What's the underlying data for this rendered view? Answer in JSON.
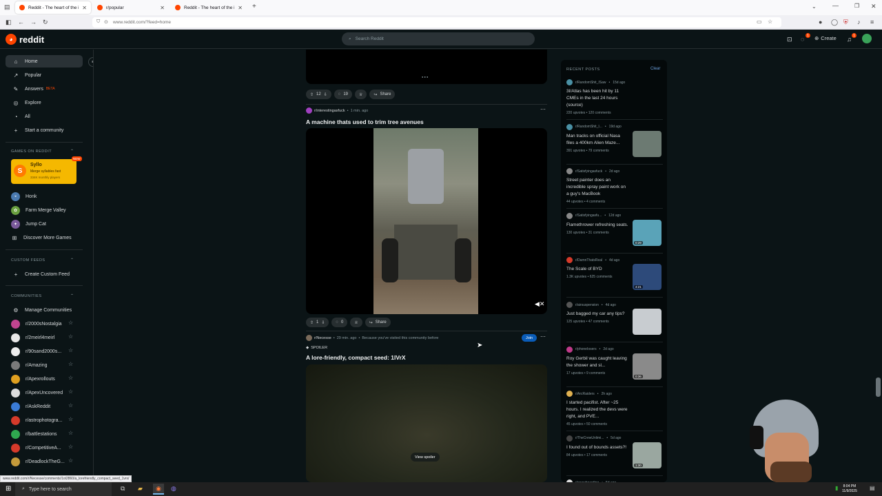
{
  "browser": {
    "tabs": [
      {
        "title": "Reddit - The heart of the intern",
        "active": true
      },
      {
        "title": "r/popular",
        "active": false
      },
      {
        "title": "Reddit - The heart of the intern",
        "active": false
      }
    ],
    "url": "www.reddit.com/?feed=home",
    "status_url": "www.reddit.com/r/Necesse/comments/1ot2860/a_lorefriendly_compact_seed_1vrx/"
  },
  "header": {
    "logo_text": "reddit",
    "search_placeholder": "Search Reddit",
    "create_label": "Create",
    "chat_badge": "1",
    "notif_badge": "1"
  },
  "sidebar": {
    "nav": [
      {
        "label": "Home",
        "icon": "home-icon",
        "selected": true
      },
      {
        "label": "Popular",
        "icon": "popular-icon"
      },
      {
        "label": "Answers",
        "icon": "answers-icon",
        "badge": "BETA"
      },
      {
        "label": "Explore",
        "icon": "explore-icon"
      },
      {
        "label": "All",
        "icon": "all-icon"
      },
      {
        "label": "Start a community",
        "icon": "plus-icon"
      }
    ],
    "games_header": "GAMES ON REDDIT",
    "featured_game": {
      "name": "Syllo",
      "desc": "Merge syllables fast",
      "players": "334K monthly players",
      "badge": "NEW"
    },
    "games": [
      "Honk",
      "Farm Merge Valley",
      "Jump Cat",
      "Discover More Games"
    ],
    "custom_feeds_header": "CUSTOM FEEDS",
    "create_feed": "Create Custom Feed",
    "communities_header": "COMMUNITIES",
    "manage": "Manage Communities",
    "communities": [
      {
        "name": "r/2000sNostalgia",
        "color": "#c0448f"
      },
      {
        "name": "r/2meirl4meirl",
        "color": "#e8e8e8"
      },
      {
        "name": "r/90sand2000s...",
        "color": "#ededed"
      },
      {
        "name": "r/Amazing",
        "color": "#7a7a7a"
      },
      {
        "name": "r/Apexrollouts",
        "color": "#e0a020"
      },
      {
        "name": "r/ApexUncovered",
        "color": "#dddddd"
      },
      {
        "name": "r/AskReddit",
        "color": "#3a7bd5"
      },
      {
        "name": "r/astrophotogra...",
        "color": "#d53a2a"
      },
      {
        "name": "r/battlestations",
        "color": "#2fa84f"
      },
      {
        "name": "r/CompetitiveA...",
        "color": "#d53a2a"
      },
      {
        "name": "r/DeadlockTheG...",
        "color": "#c49a3a"
      }
    ]
  },
  "feed": {
    "prev_post": {
      "votes": "12",
      "comments": "19",
      "share": "Share"
    },
    "post1": {
      "subreddit": "r/interestingasfuck",
      "time": "1 min. ago",
      "title": "A machine thats used to trim tree avenues",
      "votes": "1",
      "comments": "0",
      "share": "Share"
    },
    "post2": {
      "subreddit": "r/Necesse",
      "time": "29 min. ago",
      "reason": "Because you've visited this community before",
      "join": "Join",
      "flair": "SPOILER",
      "title": "A lore-friendly, compact seed: 1lVrX",
      "spoiler_button": "View spoiler"
    }
  },
  "recent": {
    "header": "RECENT POSTS",
    "clear": "Clear",
    "posts": [
      {
        "sub": "r/RandomShit_ISaw",
        "time": "15d ago",
        "title": "3I/Atlas has been hit by 11 CMEs in the last 24 hours (source)",
        "upvotes": "220 upvotes",
        "comments": "120 comments",
        "thumb": false,
        "avatar": "#4a90a4"
      },
      {
        "sub": "r/RandomShit_I...",
        "time": "19d ago",
        "title": "Man tracks on official Nasa files a 400km Alien Maze...",
        "upvotes": "391 upvotes",
        "comments": "79 comments",
        "thumb": true,
        "thumb_color": "#6c7a72",
        "duration": "",
        "avatar": "#4a90a4"
      },
      {
        "sub": "r/Satisfyingasfuck",
        "time": "2d ago",
        "title": "Street painter does an incredible spray paint work on a guy's MacBook",
        "upvotes": "44 upvotes",
        "comments": "4 comments",
        "thumb": false,
        "avatar": "#888888"
      },
      {
        "sub": "r/Satisfyingasfu...",
        "time": "12d ago",
        "title": "Flamethrower refreshing seats.",
        "upvotes": "130 upvotes",
        "comments": "31 comments",
        "thumb": true,
        "thumb_color": "#5aa3b8",
        "duration": "0:29",
        "avatar": "#888888"
      },
      {
        "sub": "r/DamnThatsReal",
        "time": "4d ago",
        "title": "The Scale of BYD",
        "upvotes": "1.3K upvotes",
        "comments": "625 comments",
        "thumb": true,
        "thumb_color": "#2d4a7a",
        "duration": "4:21",
        "avatar": "#d53a2a"
      },
      {
        "sub": "r/airsuspension",
        "time": "4d ago",
        "title": "Just bagged my car any tips?",
        "upvotes": "125 upvotes",
        "comments": "47 comments",
        "thumb": true,
        "thumb_color": "#c8ccd0",
        "duration": "",
        "avatar": "#555555"
      },
      {
        "sub": "r/phoneIosers",
        "time": "2d ago",
        "title": "Roy Gerbil was caught leaving the shower and sl...",
        "upvotes": "17 upvotes",
        "comments": "9 comments",
        "thumb": true,
        "thumb_color": "#8a8a8a",
        "duration": "0:36",
        "avatar": "#c03a8a"
      },
      {
        "sub": "r/ArcRaiders",
        "time": "2h ago",
        "title": "I started pacifist. After ~25 hours. I realized the devs were right, and PVE...",
        "upvotes": "45 upvotes",
        "comments": "50 comments",
        "thumb": false,
        "avatar": "#e0b050"
      },
      {
        "sub": "r/TheCrewUnlimi...",
        "time": "5d ago",
        "title": "I found out of bounds assets?!",
        "upvotes": "84 upvotes",
        "comments": "17 comments",
        "thumb": true,
        "thumb_color": "#9aa7a0",
        "duration": "1:30",
        "avatar": "#444444"
      },
      {
        "sub": "r/snowboarding",
        "time": "5d ago",
        "title": "",
        "upvotes": "",
        "comments": "",
        "thumb": true,
        "thumb_color": "#e8e8e8",
        "duration": "",
        "avatar": "#dddddd"
      }
    ]
  },
  "taskbar": {
    "search_placeholder": "Type here to search",
    "time": "8:04 PM",
    "date": "11/9/2025"
  }
}
